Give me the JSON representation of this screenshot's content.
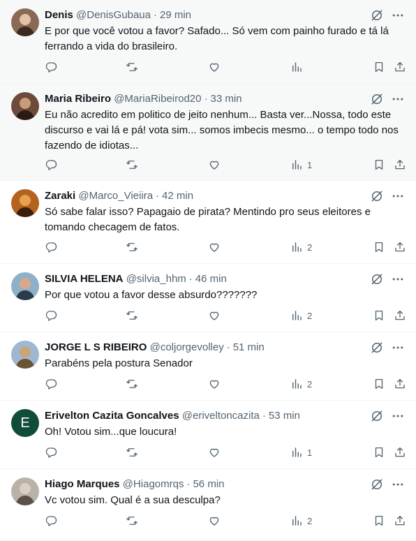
{
  "tweets": [
    {
      "name": "Denis",
      "handle": "@DenisGubaua",
      "time": "29 min",
      "text": "E por que você votou a favor? Safado... Só vem com painho furado e tá lá ferrando a vida do brasileiro.",
      "views": "",
      "shaded": true,
      "avatar": "photo"
    },
    {
      "name": "Maria Ribeiro",
      "handle": "@MariaRibeirod20",
      "time": "33 min",
      "text": "Eu não acredito em politico de jeito nenhum... Basta ver...Nossa, todo este discurso e vai lá e pá! vota sim... somos imbecis mesmo... o tempo todo nos fazendo de idiotas...",
      "views": "1",
      "shaded": true,
      "avatar": "photo"
    },
    {
      "name": "Zaraki",
      "handle": "@Marco_Vieiira",
      "time": "42 min",
      "text": "Só sabe falar isso? Papagaio de pirata? Mentindo pro seus eleitores e tomando checagem de fatos.",
      "views": "2",
      "shaded": false,
      "avatar": "photo"
    },
    {
      "name": "SILVIA HELENA",
      "handle": "@silvia_hhm",
      "time": "46 min",
      "text": "Por que votou a favor desse absurdo???????",
      "views": "2",
      "shaded": false,
      "avatar": "photo"
    },
    {
      "name": "JORGE L S RIBEIRO",
      "handle": "@coljorgevolley",
      "time": "51 min",
      "text": "Parabéns pela postura Senador",
      "views": "2",
      "shaded": false,
      "avatar": "photo"
    },
    {
      "name": "Erivelton Cazita Goncalves",
      "handle": "@eriveltoncazita",
      "time": "53 min",
      "text": "Oh! Votou sim...que loucura!",
      "views": "1",
      "shaded": false,
      "avatar": "letter",
      "avatar_letter": "E",
      "avatar_color": "#0f4c3a"
    },
    {
      "name": "Hiago Marques",
      "handle": "@Hiagomrqs",
      "time": "56 min",
      "text": "Vc votou sim. Qual é a sua desculpa?",
      "views": "2",
      "shaded": false,
      "avatar": "photo"
    }
  ],
  "separator": "·",
  "icons": {
    "grok": "grok-icon",
    "more": "more-icon",
    "reply": "reply-icon",
    "retweet": "retweet-icon",
    "like": "like-icon",
    "views": "views-icon",
    "bookmark": "bookmark-icon",
    "share": "share-icon"
  },
  "colors": {
    "text": "#0f1419",
    "secondary": "#536471",
    "shaded_bg": "#f7f9f9",
    "border": "#eff3f4"
  }
}
